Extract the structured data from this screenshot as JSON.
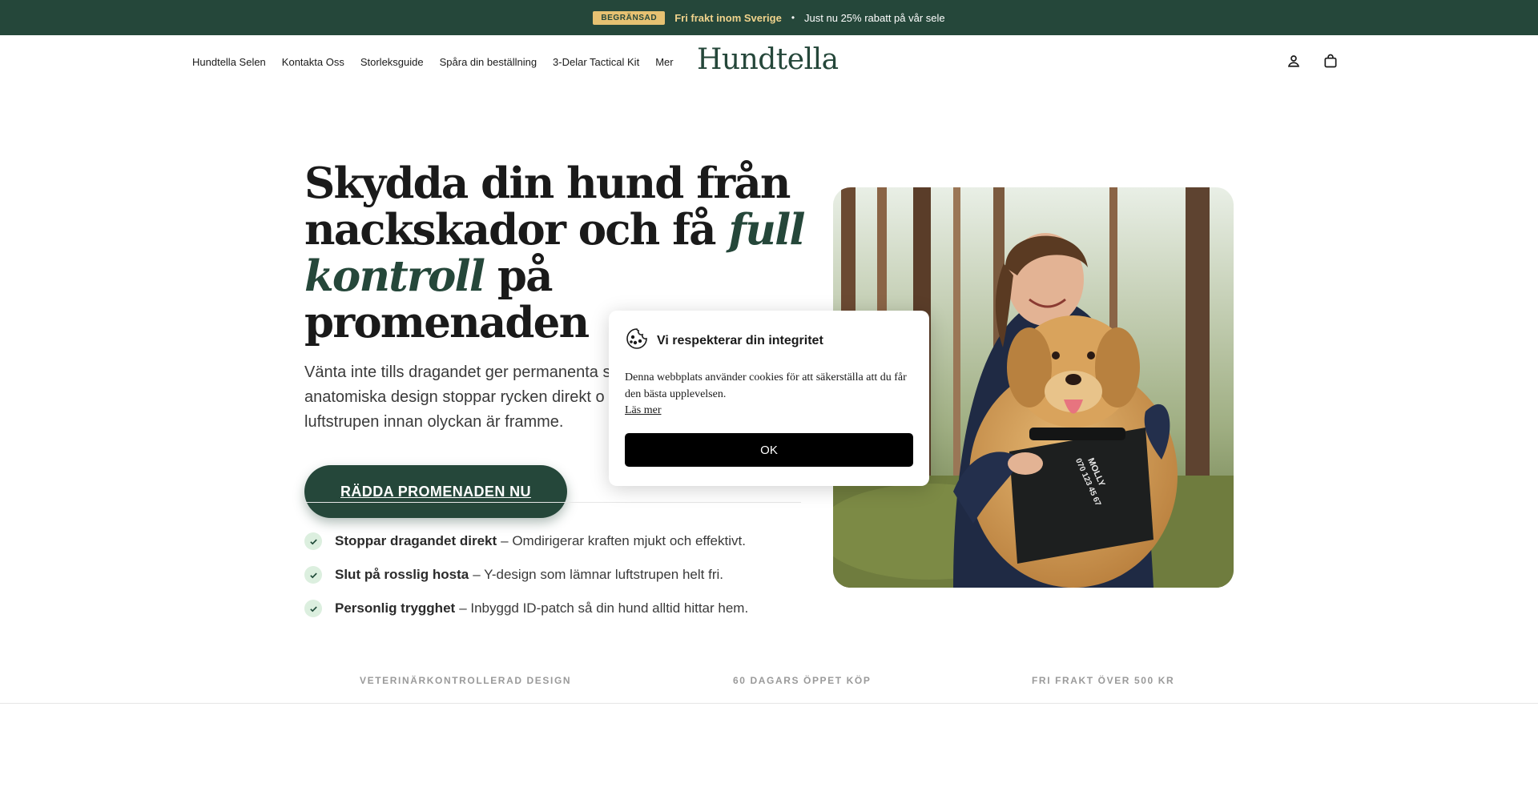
{
  "announcement": {
    "badge": "BEGRÄNSAD",
    "highlight": "Fri frakt inom Sverige",
    "separator": "•",
    "text": "Just nu 25% rabatt på vår sele"
  },
  "nav": {
    "items": [
      {
        "label": "Hundtella Selen"
      },
      {
        "label": "Kontakta Oss"
      },
      {
        "label": "Storleksguide"
      },
      {
        "label": "Spåra din beställning"
      },
      {
        "label": "3-Delar Tactical Kit"
      },
      {
        "label": "Mer"
      }
    ]
  },
  "brand": {
    "logo": "Hundtella"
  },
  "hero": {
    "title_part1": "Skydda din hund från nackskador och få ",
    "title_highlight": "full kontroll",
    "title_part2": " på promenaden",
    "lead": "Vänta inte tills dragandet ger permanenta s",
    "lead_line2": "anatomiska design stoppar rycken direkt o",
    "lead_line3": "luftstrupen innan olyckan är framme.",
    "cta": "RÄDDA PROMENADEN NU"
  },
  "benefits": [
    {
      "bold": "Stoppar dragandet direkt",
      "text": "– Omdirigerar kraften mjukt och effektivt."
    },
    {
      "bold": "Slut på rosslig hosta",
      "text": "– Y-design som lämnar luftstrupen helt fri."
    },
    {
      "bold": "Personlig trygghet",
      "text": "– Inbyggd ID-patch så din hund alltid hittar hem."
    }
  ],
  "trust": [
    "VETERINÄRKONTROLLERAD DESIGN",
    "60 DAGARS ÖPPET KÖP",
    "FRI FRAKT ÖVER 500 KR"
  ],
  "hero_image": {
    "harness_tag": "MOLLY",
    "harness_phone": "070 123 45 67"
  },
  "cookie": {
    "title": "Vi respekterar din integritet",
    "text": "Denna webbplats använder cookies för att säkerställa att du får den bästa upplevelsen.",
    "link": "Läs mer",
    "ok": "OK"
  },
  "colors": {
    "brand_green": "#25473a",
    "badge_gold": "#e6c172",
    "highlight_gold": "#f0d38c"
  },
  "icons": {
    "account": "account-icon",
    "cart": "cart-icon",
    "check": "check-icon",
    "cookie": "cookie-icon"
  }
}
